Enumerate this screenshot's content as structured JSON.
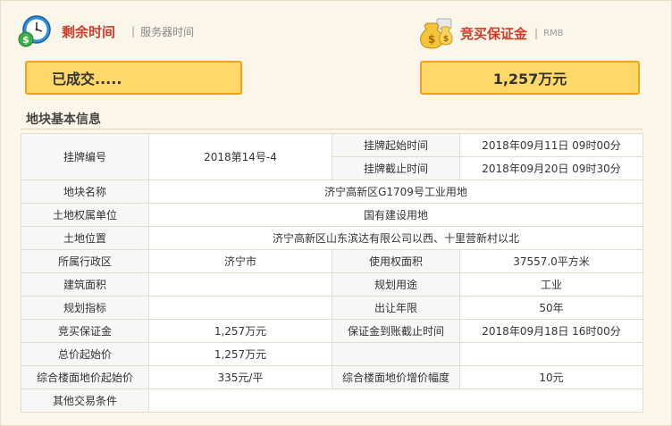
{
  "header": {
    "remaining_title": "剩余时间",
    "separator": "|",
    "server_time": "服务器时间",
    "bid_deposit_title": "竞买保证金",
    "currency": "RMB"
  },
  "status_box": {
    "text": "已成交....."
  },
  "amount_box": {
    "text": "1,257万元"
  },
  "section": {
    "title": "地块基本信息"
  },
  "table": {
    "listing_no_label": "挂牌编号",
    "listing_no_value": "2018第14号-4",
    "listing_start_label": "挂牌起始时间",
    "listing_start_value": "2018年09月11日 09时00分",
    "listing_end_label": "挂牌截止时间",
    "listing_end_value": "2018年09月20日 09时30分",
    "parcel_name_label": "地块名称",
    "parcel_name_value": "济宁高新区G1709号工业用地",
    "ownership_label": "土地权属单位",
    "ownership_value": "国有建设用地",
    "location_label": "土地位置",
    "location_value": "济宁高新区山东滨达有限公司以西、十里营新村以北",
    "district_label": "所属行政区",
    "district_value": "济宁市",
    "use_area_label": "使用权面积",
    "use_area_value": "37557.0平方米",
    "building_area_label": "建筑面积",
    "building_area_value": "",
    "planned_use_label": "规划用途",
    "planned_use_value": "工业",
    "planning_index_label": "规划指标",
    "planning_index_value": "",
    "transfer_years_label": "出让年限",
    "transfer_years_value": "50年",
    "deposit_label": "竞买保证金",
    "deposit_value": "1,257万元",
    "deposit_deadline_label": "保证金到账截止时间",
    "deposit_deadline_value": "2018年09月18日 16时00分",
    "start_price_label": "总价起始价",
    "start_price_value": "1,257万元",
    "floor_price_label": "综合楼面地价起始价",
    "floor_price_value": "335元/平",
    "increment_label": "综合楼面地价增价幅度",
    "increment_value": "10元",
    "other_label": "其他交易条件",
    "other_value": ""
  },
  "colors": {
    "accent_red": "#d23b2a",
    "box_fill": "#ffd86a",
    "box_border": "#f0a31a"
  },
  "icons": [
    "clock-dollar-icon",
    "money-bag-icon"
  ]
}
